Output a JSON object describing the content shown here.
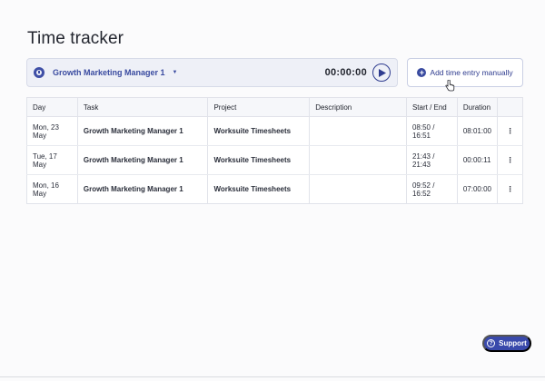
{
  "page": {
    "title": "Time tracker"
  },
  "timer": {
    "task": "Growth Marketing Manager 1",
    "elapsed": "00:00:00"
  },
  "actions": {
    "add_entry_label": "Add time entry manually"
  },
  "table": {
    "columns": {
      "day": "Day",
      "task": "Task",
      "project": "Project",
      "description": "Description",
      "start_end": "Start / End",
      "duration": "Duration"
    },
    "rows": [
      {
        "day": "Mon, 23 May",
        "task": "Growth Marketing Manager 1",
        "project": "Worksuite Timesheets",
        "description": "",
        "start_end": "08:50 / 16:51",
        "duration": "08:01:00"
      },
      {
        "day": "Tue, 17 May",
        "task": "Growth Marketing Manager 1",
        "project": "Worksuite Timesheets",
        "description": "",
        "start_end": "21:43 / 21:43",
        "duration": "00:00:11"
      },
      {
        "day": "Mon, 16 May",
        "task": "Growth Marketing Manager 1",
        "project": "Worksuite Timesheets",
        "description": "",
        "start_end": "09:52 / 16:52",
        "duration": "07:00:00"
      }
    ]
  },
  "support": {
    "label": "Support"
  },
  "colors": {
    "accent": "#3a4ba0",
    "support": "#3949ab"
  },
  "icons": {
    "task": "task-status-icon",
    "play": "play-icon",
    "add": "plus-circle-icon",
    "menu": "kebab-menu-icon",
    "help": "question-circle-icon",
    "cursor": "hand-pointer-icon"
  }
}
